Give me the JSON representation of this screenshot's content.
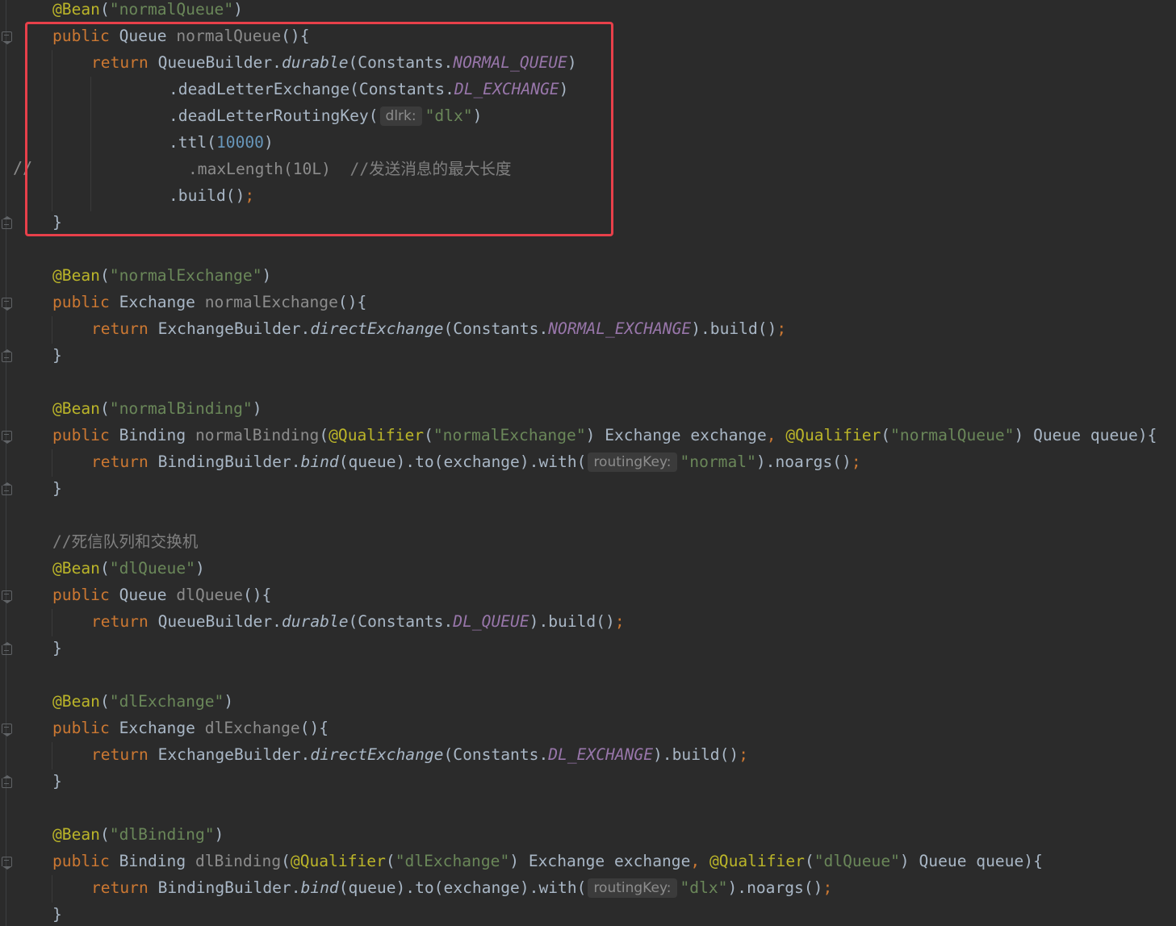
{
  "lines": {
    "l1_ann": "@Bean",
    "l1_args": "(\"normalQueue\")",
    "l2_kw": "public",
    "l2_type": " Queue ",
    "l2_name": "normalQueue",
    "l2_tail": "(){",
    "l3_kw": "return",
    "l3_a": " QueueBuilder.",
    "l3_m": "durable",
    "l3_b": "(Constants.",
    "l3_c": "NORMAL_QUEUE",
    "l3_d": ")",
    "l4_a": ".deadLetterExchange(Constants.",
    "l4_c": "DL_EXCHANGE",
    "l4_d": ")",
    "l5_a": ".deadLetterRoutingKey(",
    "l5_hint": "dlrk:",
    "l5_s": "\"dlx\"",
    "l5_d": ")",
    "l6_a": ".ttl(",
    "l6_n": "10000",
    "l6_d": ")",
    "l7_a": ".maxLength(10L)",
    "l7_cmt": "//发送消息的最大长度",
    "l7_slash": "//",
    "l8_a": ".build()",
    "l8_semi": ";",
    "l9": "}",
    "l11_ann": "@Bean",
    "l11_args": "(\"normalExchange\")",
    "l12_kw": "public",
    "l12_type": " Exchange ",
    "l12_name": "normalExchange",
    "l12_tail": "(){",
    "l13_kw": "return",
    "l13_a": " ExchangeBuilder.",
    "l13_m": "directExchange",
    "l13_b": "(Constants.",
    "l13_c": "NORMAL_EXCHANGE",
    "l13_d": ").build()",
    "l13_semi": ";",
    "l14": "}",
    "l16_ann": "@Bean",
    "l16_args": "(\"normalBinding\")",
    "l17_kw": "public",
    "l17_type": " Binding ",
    "l17_name": "normalBinding",
    "l17_p1": "(",
    "l17_q1": "@Qualifier",
    "l17_q1s": "(\"normalExchange\")",
    "l17_p2": " Exchange exchange",
    "l17_comma": ", ",
    "l17_q2": "@Qualifier",
    "l17_q2s": "(\"normalQueue\")",
    "l17_p3": " Queue queue){",
    "l18_kw": "return",
    "l18_a": " BindingBuilder.",
    "l18_m": "bind",
    "l18_b": "(queue).to(exchange).with(",
    "l18_hint": "routingKey:",
    "l18_s": "\"normal\"",
    "l18_d": ").noargs()",
    "l18_semi": ";",
    "l19": "}",
    "l21_cmt": "//死信队列和交换机",
    "l22_ann": "@Bean",
    "l22_args": "(\"dlQueue\")",
    "l23_kw": "public",
    "l23_type": " Queue ",
    "l23_name": "dlQueue",
    "l23_tail": "(){",
    "l24_kw": "return",
    "l24_a": " QueueBuilder.",
    "l24_m": "durable",
    "l24_b": "(Constants.",
    "l24_c": "DL_QUEUE",
    "l24_d": ").build()",
    "l24_semi": ";",
    "l25": "}",
    "l27_ann": "@Bean",
    "l27_args": "(\"dlExchange\")",
    "l28_kw": "public",
    "l28_type": " Exchange ",
    "l28_name": "dlExchange",
    "l28_tail": "(){",
    "l29_kw": "return",
    "l29_a": " ExchangeBuilder.",
    "l29_m": "directExchange",
    "l29_b": "(Constants.",
    "l29_c": "DL_EXCHANGE",
    "l29_d": ").build()",
    "l29_semi": ";",
    "l30": "}",
    "l32_ann": "@Bean",
    "l32_args": "(\"dlBinding\")",
    "l33_kw": "public",
    "l33_type": " Binding ",
    "l33_name": "dlBinding",
    "l33_p1": "(",
    "l33_q1": "@Qualifier",
    "l33_q1s": "(\"dlExchange\")",
    "l33_p2": " Exchange exchange",
    "l33_comma": ", ",
    "l33_q2": "@Qualifier",
    "l33_q2s": "(\"dlQueue\")",
    "l33_p3": " Queue queue){",
    "l34_kw": "return",
    "l34_a": " BindingBuilder.",
    "l34_m": "bind",
    "l34_b": "(queue).to(exchange).with(",
    "l34_hint": "routingKey:",
    "l34_s": "\"dlx\"",
    "l34_d": ").noargs()",
    "l34_semi": ";",
    "l35": "}"
  },
  "colors": {
    "background": "#2b2b2b",
    "keyword": "#cc7832",
    "annotation": "#bbb529",
    "string": "#6a8759",
    "number": "#6897bb",
    "static_field": "#9876aa",
    "comment": "#808080",
    "highlight_box": "#e8404a"
  }
}
